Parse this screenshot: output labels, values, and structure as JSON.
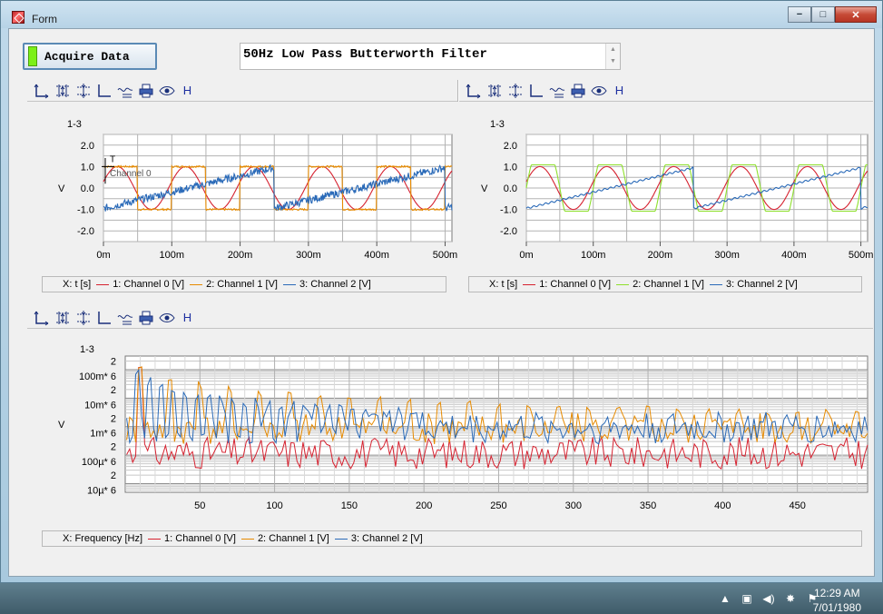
{
  "window": {
    "title": "Form",
    "minimize": "−",
    "maximize": "□",
    "close": "✕"
  },
  "controls": {
    "acquire_label": "Acquire Data",
    "filter_text": "50Hz Low Pass Butterworth Filter",
    "led_color": "#7cf019"
  },
  "toolbar_icons": [
    "axes-icon",
    "y-zoom-icon",
    "y-fit-icon",
    "cursor-icon",
    "trace-icon",
    "print-icon",
    "eye-icon",
    "h-icon"
  ],
  "toolbar_h_label": "H",
  "colors": {
    "channel0": "#d62230",
    "channel1_top": "#e68a00",
    "channel1_right": "#8ee02c",
    "channel2": "#2a6ab8",
    "grid": "#b3b3b3"
  },
  "chart_top_left": {
    "type": "line",
    "scale_label": "1-3",
    "ylabel": "V",
    "yticks": [
      "2.0",
      "1.0",
      "0.0",
      "-1.0",
      "-2.0"
    ],
    "xticks": [
      "0m",
      "100m",
      "200m",
      "300m",
      "400m",
      "500m"
    ],
    "ylim": [
      -2.5,
      2.5
    ],
    "xlim": [
      0,
      0.51
    ],
    "cursor_label": "T",
    "cursor_channel": "Channel 0",
    "legend": {
      "x": "X: t [s]",
      "series": [
        "1: Channel 0 [V]",
        "2: Channel 1 [V]",
        "3: Channel 2 [V]"
      ]
    },
    "series": [
      {
        "name": "1: Channel 0 [V]",
        "signal": "sine",
        "freq_hz": 10,
        "amplitude": 1.0
      },
      {
        "name": "2: Channel 1 [V]",
        "signal": "square",
        "freq_hz": 10,
        "amplitude": 1.0
      },
      {
        "name": "3: Channel 2 [V]",
        "signal": "sawtooth_noisy",
        "freq_hz": 4,
        "amplitude": 1.0
      }
    ]
  },
  "chart_top_right": {
    "type": "line",
    "scale_label": "1-3",
    "ylabel": "V",
    "yticks": [
      "2.0",
      "1.0",
      "0.0",
      "-1.0",
      "-2.0"
    ],
    "xticks": [
      "0m",
      "100m",
      "200m",
      "300m",
      "400m",
      "500m"
    ],
    "ylim": [
      -2.5,
      2.5
    ],
    "xlim": [
      0,
      0.51
    ],
    "legend": {
      "x": "X: t [s]",
      "series": [
        "1: Channel 0 [V]",
        "2: Channel 1 [V]",
        "3: Channel 2 [V]"
      ]
    },
    "series": [
      {
        "name": "1: Channel 0 [V]",
        "signal": "sine",
        "freq_hz": 10,
        "amplitude": 1.0
      },
      {
        "name": "2: Channel 1 [V]",
        "signal": "filtered_square",
        "freq_hz": 10,
        "amplitude": 1.0
      },
      {
        "name": "3: Channel 2 [V]",
        "signal": "sawtooth",
        "freq_hz": 4,
        "amplitude": 1.0
      }
    ]
  },
  "chart_bottom": {
    "type": "line",
    "scale_label": "1-3",
    "ylabel": "V",
    "yticks": [
      "2",
      "100m* 6",
      "2",
      "10m* 6",
      "2",
      "1m* 6",
      "2",
      "100µ* 6",
      "2",
      "10µ* 6"
    ],
    "xticks": [
      "50",
      "100",
      "150",
      "200",
      "250",
      "300",
      "350",
      "400",
      "450"
    ],
    "xlim": [
      0,
      497
    ],
    "log_scale_y": true,
    "legend": {
      "x": "X: Frequency [Hz]",
      "series": [
        "1: Channel 0 [V]",
        "2: Channel 1 [V]",
        "3: Channel 2 [V]"
      ]
    },
    "series": [
      {
        "name": "1: Channel 0 [V]",
        "signal": "spectrum_peak",
        "peak_hz": 10,
        "floor": "low"
      },
      {
        "name": "2: Channel 1 [V]",
        "signal": "spectrum_odd_harmonics",
        "peak_hz": 10,
        "floor": "mid"
      },
      {
        "name": "3: Channel 2 [V]",
        "signal": "spectrum_harmonics",
        "peak_hz": 4,
        "floor": "mid"
      }
    ]
  },
  "taskbar": {
    "time": "12:29 AM",
    "date": "7/01/1980",
    "tray_icons": [
      "show-hidden-icon",
      "network-icon",
      "volume-icon",
      "power-icon",
      "flag-icon"
    ]
  }
}
